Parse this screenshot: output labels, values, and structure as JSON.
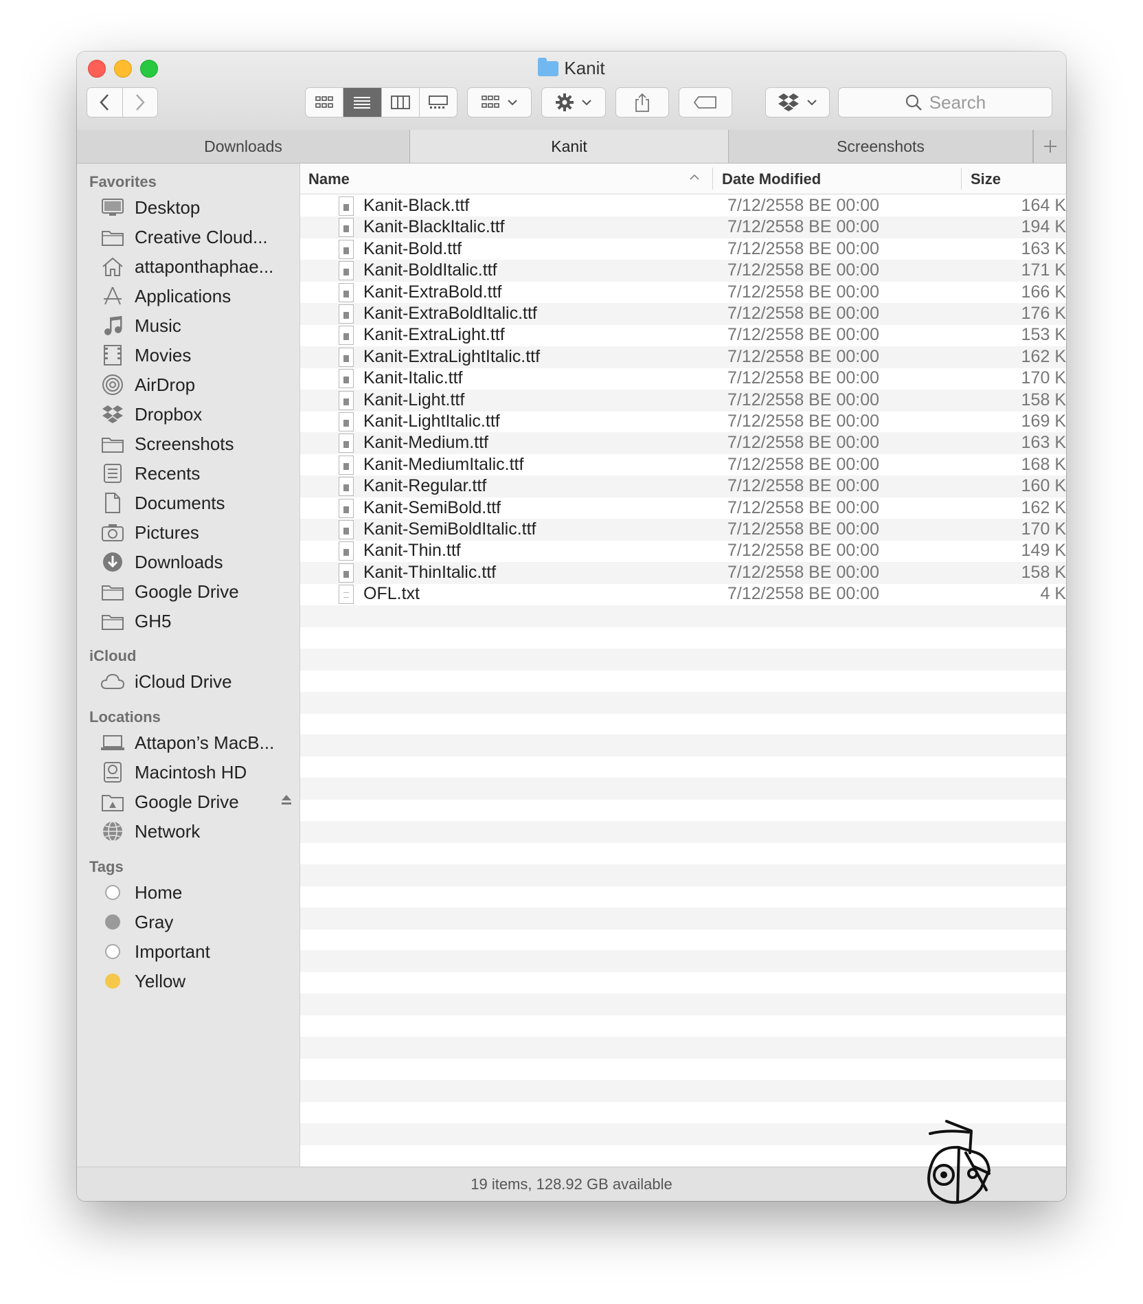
{
  "window": {
    "title": "Kanit"
  },
  "toolbar": {
    "back_icon": "chevron-left-icon",
    "forward_icon": "chevron-right-icon",
    "search_placeholder": "Search"
  },
  "tabs": [
    {
      "label": "Downloads"
    },
    {
      "label": "Kanit",
      "active": true
    },
    {
      "label": "Screenshots"
    }
  ],
  "sidebar": {
    "favorites_heading": "Favorites",
    "favorites": [
      {
        "label": "Desktop",
        "icon": "desktop-icon"
      },
      {
        "label": "Creative Cloud...",
        "icon": "folder-icon"
      },
      {
        "label": "attaponthaphae...",
        "icon": "home-icon"
      },
      {
        "label": "Applications",
        "icon": "applications-icon"
      },
      {
        "label": "Music",
        "icon": "music-icon"
      },
      {
        "label": "Movies",
        "icon": "movies-icon"
      },
      {
        "label": "AirDrop",
        "icon": "airdrop-icon"
      },
      {
        "label": "Dropbox",
        "icon": "dropbox-icon"
      },
      {
        "label": "Screenshots",
        "icon": "folder-icon"
      },
      {
        "label": "Recents",
        "icon": "recents-icon"
      },
      {
        "label": "Documents",
        "icon": "documents-icon"
      },
      {
        "label": "Pictures",
        "icon": "pictures-icon"
      },
      {
        "label": "Downloads",
        "icon": "downloads-icon"
      },
      {
        "label": "Google Drive",
        "icon": "folder-icon"
      },
      {
        "label": "GH5",
        "icon": "folder-icon"
      }
    ],
    "icloud_heading": "iCloud",
    "icloud": [
      {
        "label": "iCloud Drive",
        "icon": "cloud-icon"
      }
    ],
    "locations_heading": "Locations",
    "locations": [
      {
        "label": "Attapon’s MacB...",
        "icon": "laptop-icon"
      },
      {
        "label": "Macintosh HD",
        "icon": "harddisk-icon"
      },
      {
        "label": "Google Drive",
        "icon": "google-drive-icon",
        "eject": true
      },
      {
        "label": "Network",
        "icon": "network-icon"
      }
    ],
    "tags_heading": "Tags",
    "tags": [
      {
        "label": "Home",
        "color": "#ffffff"
      },
      {
        "label": "Gray",
        "color": "#9a9a9a"
      },
      {
        "label": "Important",
        "color": "#ffffff"
      },
      {
        "label": "Yellow",
        "color": "#f5c74a"
      }
    ]
  },
  "columns": {
    "name": "Name",
    "date": "Date Modified",
    "size": "Size"
  },
  "files": [
    {
      "name": "Kanit-Black.ttf",
      "date": "7/12/2558 BE 00:00",
      "size": "164 K",
      "type": "font"
    },
    {
      "name": "Kanit-BlackItalic.ttf",
      "date": "7/12/2558 BE 00:00",
      "size": "194 K",
      "type": "font"
    },
    {
      "name": "Kanit-Bold.ttf",
      "date": "7/12/2558 BE 00:00",
      "size": "163 K",
      "type": "font"
    },
    {
      "name": "Kanit-BoldItalic.ttf",
      "date": "7/12/2558 BE 00:00",
      "size": "171 K",
      "type": "font"
    },
    {
      "name": "Kanit-ExtraBold.ttf",
      "date": "7/12/2558 BE 00:00",
      "size": "166 K",
      "type": "font"
    },
    {
      "name": "Kanit-ExtraBoldItalic.ttf",
      "date": "7/12/2558 BE 00:00",
      "size": "176 K",
      "type": "font"
    },
    {
      "name": "Kanit-ExtraLight.ttf",
      "date": "7/12/2558 BE 00:00",
      "size": "153 K",
      "type": "font"
    },
    {
      "name": "Kanit-ExtraLightItalic.ttf",
      "date": "7/12/2558 BE 00:00",
      "size": "162 K",
      "type": "font"
    },
    {
      "name": "Kanit-Italic.ttf",
      "date": "7/12/2558 BE 00:00",
      "size": "170 K",
      "type": "font"
    },
    {
      "name": "Kanit-Light.ttf",
      "date": "7/12/2558 BE 00:00",
      "size": "158 K",
      "type": "font"
    },
    {
      "name": "Kanit-LightItalic.ttf",
      "date": "7/12/2558 BE 00:00",
      "size": "169 K",
      "type": "font"
    },
    {
      "name": "Kanit-Medium.ttf",
      "date": "7/12/2558 BE 00:00",
      "size": "163 K",
      "type": "font"
    },
    {
      "name": "Kanit-MediumItalic.ttf",
      "date": "7/12/2558 BE 00:00",
      "size": "168 K",
      "type": "font"
    },
    {
      "name": "Kanit-Regular.ttf",
      "date": "7/12/2558 BE 00:00",
      "size": "160 K",
      "type": "font"
    },
    {
      "name": "Kanit-SemiBold.ttf",
      "date": "7/12/2558 BE 00:00",
      "size": "162 K",
      "type": "font"
    },
    {
      "name": "Kanit-SemiBoldItalic.ttf",
      "date": "7/12/2558 BE 00:00",
      "size": "170 K",
      "type": "font"
    },
    {
      "name": "Kanit-Thin.ttf",
      "date": "7/12/2558 BE 00:00",
      "size": "149 K",
      "type": "font"
    },
    {
      "name": "Kanit-ThinItalic.ttf",
      "date": "7/12/2558 BE 00:00",
      "size": "158 K",
      "type": "font"
    },
    {
      "name": "OFL.txt",
      "date": "7/12/2558 BE 00:00",
      "size": "4 K",
      "type": "text"
    }
  ],
  "status": {
    "text": "19 items, 128.92 GB available"
  }
}
